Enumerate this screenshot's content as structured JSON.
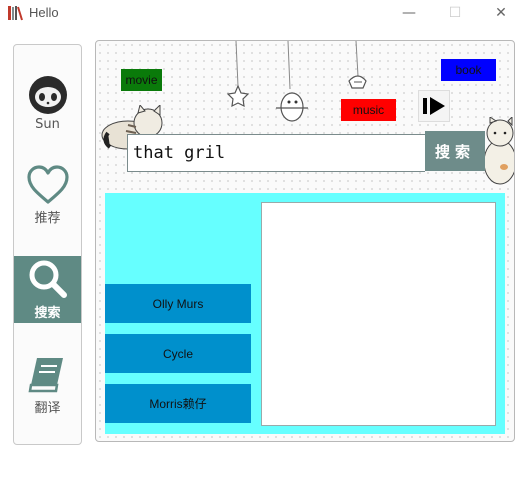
{
  "window": {
    "title": "Hello",
    "minimize_glyph": "—",
    "maximize_glyph": "☐",
    "close_glyph": "✕"
  },
  "sidebar": {
    "items": [
      {
        "label": "Sun",
        "icon": "github-cat-icon"
      },
      {
        "label": "推荐",
        "icon": "heart-icon"
      },
      {
        "label": "搜索",
        "icon": "search-icon",
        "active": true
      },
      {
        "label": "翻译",
        "icon": "book-icon"
      }
    ]
  },
  "categories": {
    "movie": "movie",
    "music": "music",
    "book": "book"
  },
  "search": {
    "value": "that gril",
    "button_label": "搜索"
  },
  "results": [
    "Olly Murs",
    "Cycle",
    "Morris赖仔"
  ],
  "colors": {
    "accent": "#5f8a84",
    "results_bg": "#66ffff",
    "result_item": "#0090cc",
    "movie": "#0a7a0a",
    "music": "#ff0000",
    "book": "#0000ff"
  }
}
